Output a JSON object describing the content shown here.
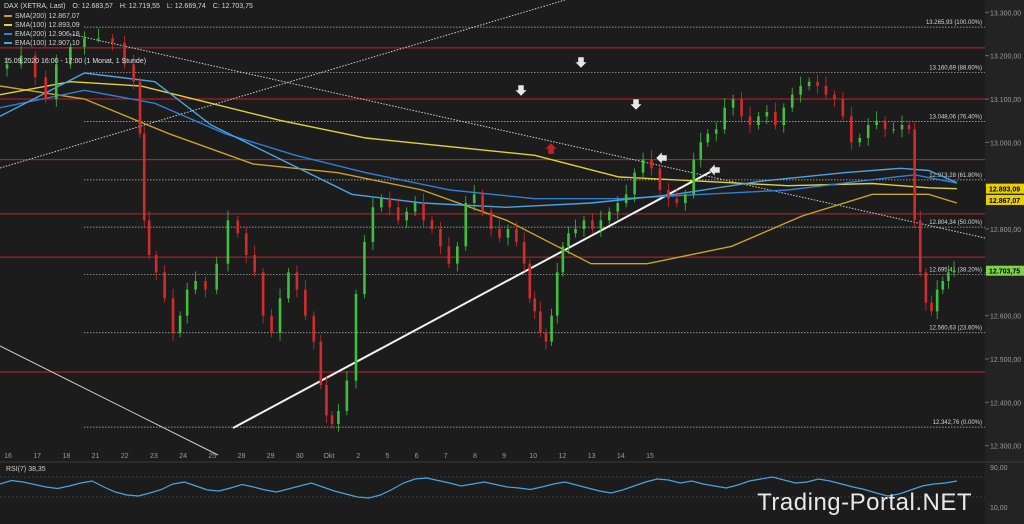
{
  "header": {
    "symbol": "DAX (XETRA, Last)",
    "open": "O: 12.683,57",
    "high": "H: 12.719,55",
    "low": "L: 12.669,74",
    "close": "C: 12.703,75",
    "interval": "15.09.2020 16:00 - 17:00  (1 Monat, 1 Stunde)"
  },
  "indicators": [
    {
      "name": "SMA(200)",
      "value": "12.867,07",
      "color": "#c9a227"
    },
    {
      "name": "SMA(100)",
      "value": "12.893,09",
      "color": "#e3d13a"
    },
    {
      "name": "EMA(200)",
      "value": "12.906,18",
      "color": "#2f7fd6"
    },
    {
      "name": "EMA(100)",
      "value": "12.907,10",
      "color": "#4aa3e0"
    }
  ],
  "rsi": {
    "label": "RSI(7)",
    "value": "38,35"
  },
  "watermark": "Trading-Portal.NET",
  "price_badges": [
    {
      "text": "12.893,09",
      "value": 12893.09,
      "color": "#e8d000"
    },
    {
      "text": "12.867,07",
      "value": 12867.07,
      "color": "#e8d000"
    },
    {
      "text": "12.703,75",
      "value": 12703.75,
      "color": "#7fd24a"
    }
  ],
  "chart_data": {
    "type": "line",
    "title": "",
    "ylim": [
      12290,
      13310
    ],
    "y_ticks": [
      {
        "value": 13300,
        "label": "13.300,00"
      },
      {
        "value": 13200,
        "label": "13.200,00"
      },
      {
        "value": 13100,
        "label": "13.100,00"
      },
      {
        "value": 13000,
        "label": "13.000,00"
      },
      {
        "value": 12900,
        "label": "12.900,00"
      },
      {
        "value": 12800,
        "label": "12.800,00"
      },
      {
        "value": 12700,
        "label": "12.700,00"
      },
      {
        "value": 12600,
        "label": "12.600,00"
      },
      {
        "value": 12500,
        "label": "12.500,00"
      },
      {
        "value": 12400,
        "label": "12.400,00"
      },
      {
        "value": 12300,
        "label": "12.300,00"
      }
    ],
    "x_ticks": [
      "16",
      "17",
      "18",
      "21",
      "22",
      "23",
      "24",
      "25",
      "28",
      "29",
      "30",
      "Okt",
      "2",
      "5",
      "6",
      "7",
      "8",
      "9",
      "10",
      "12",
      "13",
      "14",
      "15"
    ],
    "fib_levels": [
      {
        "value": 13265.93,
        "label": "13.265,93 (100.00%)"
      },
      {
        "value": 13160.69,
        "label": "13.160,69 (88.60%)"
      },
      {
        "value": 13048.06,
        "label": "13.048,06 (76.40%)"
      },
      {
        "value": 12913.28,
        "label": "12.913,28 (61.80%)"
      },
      {
        "value": 12804.34,
        "label": "12.804,34 (50.00%)"
      },
      {
        "value": 12695.41,
        "label": "12.695,41 (38.20%)"
      },
      {
        "value": 12560.63,
        "label": "12.560,63 (23.60%)"
      },
      {
        "value": 12342.76,
        "label": "12.342,76 (0.00%)"
      }
    ],
    "red_levels": [
      13218,
      13100,
      12960,
      12835,
      12735,
      12470
    ],
    "price_series": [
      [
        0,
        13170
      ],
      [
        10,
        13180
      ],
      [
        20,
        13200
      ],
      [
        30,
        13150
      ],
      [
        35,
        13100
      ],
      [
        45,
        13180
      ],
      [
        55,
        13220
      ],
      [
        65,
        13240
      ],
      [
        75,
        13240
      ],
      [
        85,
        13230
      ],
      [
        92,
        13180
      ],
      [
        98,
        13140
      ],
      [
        101,
        13020
      ],
      [
        104,
        12820
      ],
      [
        108,
        12740
      ],
      [
        114,
        12700
      ],
      [
        120,
        12640
      ],
      [
        126,
        12560
      ],
      [
        130,
        12600
      ],
      [
        136,
        12660
      ],
      [
        142,
        12680
      ],
      [
        150,
        12660
      ],
      [
        158,
        12720
      ],
      [
        166,
        12820
      ],
      [
        172,
        12790
      ],
      [
        178,
        12740
      ],
      [
        184,
        12700
      ],
      [
        190,
        12600
      ],
      [
        196,
        12560
      ],
      [
        202,
        12640
      ],
      [
        208,
        12700
      ],
      [
        214,
        12660
      ],
      [
        220,
        12600
      ],
      [
        226,
        12540
      ],
      [
        230,
        12440
      ],
      [
        234,
        12370
      ],
      [
        238,
        12350
      ],
      [
        243,
        12380
      ],
      [
        250,
        12450
      ],
      [
        256,
        12650
      ],
      [
        262,
        12770
      ],
      [
        268,
        12850
      ],
      [
        274,
        12870
      ],
      [
        280,
        12850
      ],
      [
        286,
        12820
      ],
      [
        292,
        12840
      ],
      [
        298,
        12860
      ],
      [
        304,
        12820
      ],
      [
        310,
        12800
      ],
      [
        316,
        12760
      ],
      [
        322,
        12720
      ],
      [
        328,
        12760
      ],
      [
        334,
        12860
      ],
      [
        340,
        12880
      ],
      [
        346,
        12840
      ],
      [
        352,
        12800
      ],
      [
        358,
        12780
      ],
      [
        364,
        12800
      ],
      [
        370,
        12770
      ],
      [
        375,
        12720
      ],
      [
        378,
        12640
      ],
      [
        382,
        12610
      ],
      [
        386,
        12560
      ],
      [
        390,
        12540
      ],
      [
        394,
        12600
      ],
      [
        398,
        12700
      ],
      [
        402,
        12760
      ],
      [
        406,
        12790
      ],
      [
        412,
        12800
      ],
      [
        418,
        12820
      ],
      [
        424,
        12800
      ],
      [
        430,
        12820
      ],
      [
        436,
        12840
      ],
      [
        442,
        12860
      ],
      [
        448,
        12880
      ],
      [
        454,
        12930
      ],
      [
        460,
        12960
      ],
      [
        466,
        12940
      ],
      [
        472,
        12890
      ],
      [
        478,
        12870
      ],
      [
        484,
        12860
      ],
      [
        490,
        12880
      ],
      [
        496,
        12960
      ],
      [
        500,
        13000
      ],
      [
        506,
        13020
      ],
      [
        512,
        13030
      ],
      [
        518,
        13080
      ],
      [
        524,
        13100
      ],
      [
        530,
        13060
      ],
      [
        536,
        13040
      ],
      [
        542,
        13060
      ],
      [
        548,
        13070
      ],
      [
        554,
        13040
      ],
      [
        560,
        13080
      ],
      [
        566,
        13110
      ],
      [
        572,
        13130
      ],
      [
        578,
        13140
      ],
      [
        584,
        13130
      ],
      [
        590,
        13110
      ],
      [
        596,
        13100
      ],
      [
        602,
        13060
      ],
      [
        608,
        13000
      ],
      [
        614,
        13010
      ],
      [
        620,
        13040
      ],
      [
        626,
        13050
      ],
      [
        632,
        13030
      ],
      [
        638,
        13030
      ],
      [
        644,
        13040
      ],
      [
        648,
        13030
      ],
      [
        652,
        12820
      ],
      [
        656,
        12700
      ],
      [
        660,
        12630
      ],
      [
        664,
        12610
      ],
      [
        668,
        12660
      ],
      [
        672,
        12680
      ],
      [
        676,
        12700
      ],
      [
        680,
        12704
      ]
    ],
    "series": [
      {
        "name": "SMA(200)",
        "color": "#c9a227",
        "values": [
          [
            0,
            13130
          ],
          [
            60,
            13100
          ],
          [
            120,
            13020
          ],
          [
            180,
            12950
          ],
          [
            240,
            12930
          ],
          [
            300,
            12890
          ],
          [
            360,
            12820
          ],
          [
            420,
            12720
          ],
          [
            460,
            12720
          ],
          [
            520,
            12760
          ],
          [
            570,
            12830
          ],
          [
            620,
            12880
          ],
          [
            660,
            12880
          ],
          [
            680,
            12860
          ]
        ]
      },
      {
        "name": "SMA(100)",
        "color": "#e3d13a",
        "values": [
          [
            0,
            13110
          ],
          [
            50,
            13140
          ],
          [
            100,
            13130
          ],
          [
            150,
            13090
          ],
          [
            200,
            13050
          ],
          [
            260,
            13010
          ],
          [
            320,
            12990
          ],
          [
            380,
            12970
          ],
          [
            440,
            12920
          ],
          [
            500,
            12910
          ],
          [
            560,
            12900
          ],
          [
            620,
            12905
          ],
          [
            660,
            12895
          ],
          [
            680,
            12893
          ]
        ]
      },
      {
        "name": "EMA(200)",
        "color": "#2f7fd6",
        "values": [
          [
            0,
            13080
          ],
          [
            60,
            13120
          ],
          [
            110,
            13090
          ],
          [
            160,
            13020
          ],
          [
            210,
            12970
          ],
          [
            260,
            12930
          ],
          [
            320,
            12890
          ],
          [
            380,
            12870
          ],
          [
            440,
            12870
          ],
          [
            500,
            12880
          ],
          [
            560,
            12890
          ],
          [
            610,
            12910
          ],
          [
            650,
            12925
          ],
          [
            680,
            12906
          ]
        ]
      },
      {
        "name": "EMA(100)",
        "color": "#4aa3e0",
        "values": [
          [
            0,
            13060
          ],
          [
            60,
            13160
          ],
          [
            110,
            13140
          ],
          [
            150,
            13040
          ],
          [
            200,
            12960
          ],
          [
            250,
            12880
          ],
          [
            300,
            12860
          ],
          [
            360,
            12850
          ],
          [
            420,
            12860
          ],
          [
            480,
            12880
          ],
          [
            540,
            12910
          ],
          [
            600,
            12930
          ],
          [
            640,
            12940
          ],
          [
            660,
            12935
          ],
          [
            680,
            12907
          ]
        ]
      }
    ],
    "rsi_series": [
      56,
      63,
      60,
      55,
      50,
      47,
      52,
      58,
      62,
      50,
      40,
      34,
      32,
      38,
      45,
      56,
      60,
      52,
      44,
      42,
      48,
      55,
      50,
      44,
      40,
      46,
      52,
      58,
      50,
      42,
      36,
      30,
      28,
      34,
      45,
      58,
      66,
      68,
      63,
      58,
      52,
      56,
      60,
      55,
      50,
      48,
      45,
      50,
      56,
      60,
      54,
      48,
      42,
      38,
      44,
      52,
      60,
      66,
      64,
      58,
      62,
      56,
      52,
      48,
      54,
      62,
      66,
      70,
      64,
      58,
      60,
      66,
      62,
      56,
      50,
      45,
      38,
      32,
      36,
      44,
      52,
      56,
      58,
      62
    ]
  }
}
